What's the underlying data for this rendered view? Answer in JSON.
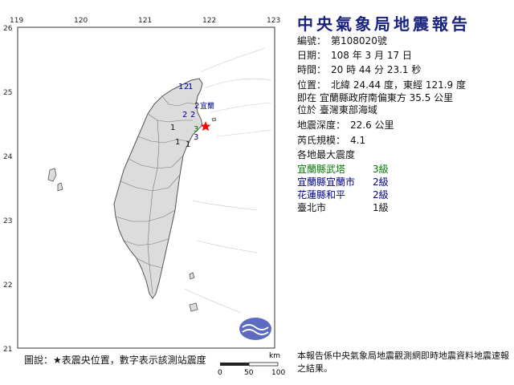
{
  "report": {
    "title": "中央氣象局地震報告",
    "number_label": "編號：",
    "number_value": "第108020號",
    "date_label": "日期：",
    "date_value": "108 年 3 月 17 日",
    "time_label": "時間：",
    "time_value": "20 時 44 分 23.1 秒",
    "location_label": "位置：",
    "location_value": "北緯 24.44 度，東經 121.9 度",
    "location_line2": "即在 宜蘭縣政府南偏東方 35.5 公里",
    "location_line3": "位於 臺灣東部海域",
    "depth_label": "地震深度：",
    "depth_value": "22.6 公里",
    "magnitude_label": "芮氏規模：",
    "magnitude_value": "4.1",
    "intensity_heading": "各地最大震度",
    "stations": [
      {
        "name": "宜蘭縣武塔",
        "level": "3級",
        "color": "#007a00"
      },
      {
        "name": "宜蘭縣宜蘭市",
        "level": "2級",
        "color": "#00008b"
      },
      {
        "name": "花蓮縣和平",
        "level": "2級",
        "color": "#00008b"
      },
      {
        "name": "臺北市",
        "level": "1級",
        "color": "#111111"
      }
    ],
    "footer": "本報告係中央氣象局地震觀測網即時地震資料地震速報之結果。"
  },
  "map": {
    "lon_ticks": [
      "119",
      "120",
      "121",
      "122",
      "123"
    ],
    "lat_ticks": [
      "26",
      "25",
      "24",
      "23",
      "22",
      "21"
    ],
    "legend": "圖說：★表震央位置，數字表示該測站震度",
    "scale_unit": "km",
    "scale_labels": [
      "0",
      "50",
      "100"
    ],
    "station_marks": [
      {
        "text": "1",
        "color": "#00008b"
      },
      {
        "text": "2",
        "color": "#00008b"
      },
      {
        "text": "1",
        "color": "#00008b"
      },
      {
        "text": "2",
        "color": "#00008b"
      },
      {
        "text": "宜蘭",
        "color": "#00008b"
      },
      {
        "text": "2",
        "color": "#00008b"
      },
      {
        "text": "2",
        "color": "#00008b"
      },
      {
        "text": "1",
        "color": "#111111"
      },
      {
        "text": "3",
        "color": "#007a00"
      },
      {
        "text": "3",
        "color": "#00008b"
      },
      {
        "text": "1",
        "color": "#111111"
      },
      {
        "text": "1",
        "color": "#111111"
      }
    ],
    "colors": {
      "land": "#dcdcdc",
      "land_edge": "#555555",
      "epicenter": "#ff0000",
      "ocean": "#ffffff"
    }
  }
}
